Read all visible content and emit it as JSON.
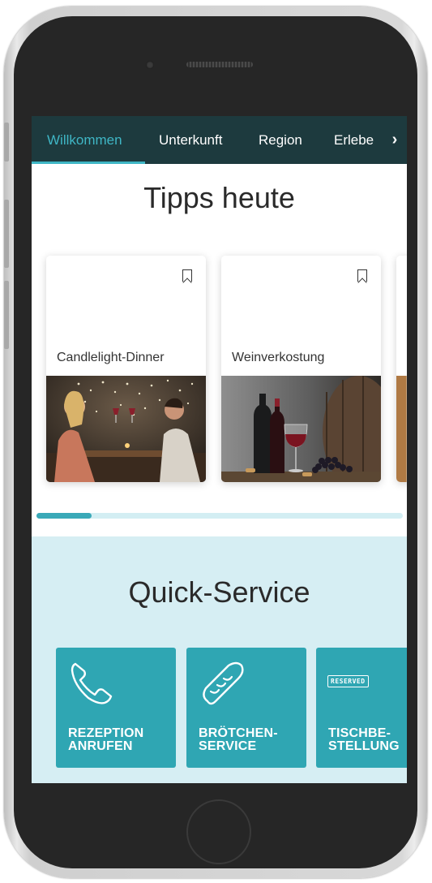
{
  "nav": {
    "tabs": [
      "Willkommen",
      "Unterkunft",
      "Region",
      "Erlebe"
    ],
    "active_index": 0
  },
  "tips": {
    "title": "Tipps heute",
    "cards": [
      {
        "title": "Candlelight-Dinner"
      },
      {
        "title": "Weinverkostung"
      }
    ],
    "scroll_progress": 0.15
  },
  "quick_service": {
    "title": "Quick-Service",
    "items": [
      {
        "line1": "REZEPTION",
        "line2": "ANRUFEN",
        "icon": "phone-icon"
      },
      {
        "line1": "BRÖTCHEN-",
        "line2": "SERVICE",
        "icon": "bread-icon"
      },
      {
        "line1": "TISCHBE-",
        "line2": "STELLUNG",
        "icon": "reserved-sign-icon",
        "sign_text": "RESERVED"
      }
    ]
  },
  "colors": {
    "nav_bg": "#1d3a3e",
    "accent": "#3fb6c5",
    "tile": "#2fa6b3",
    "quick_bg": "#d6eef3"
  }
}
